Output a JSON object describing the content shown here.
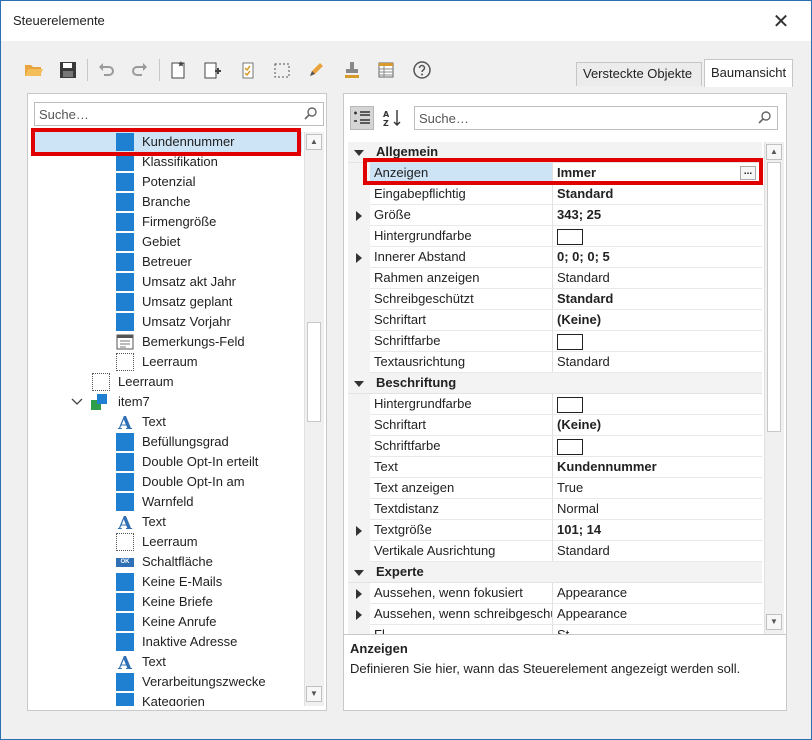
{
  "window": {
    "title": "Steuerelemente",
    "close_glyph": "✕"
  },
  "toolbar": {
    "icons": [
      "open-folder-icon",
      "save-icon",
      "undo-icon",
      "redo-icon",
      "new-document-icon",
      "add-icon",
      "checklist-icon",
      "select-icon",
      "pencil-icon",
      "stamp-icon",
      "table-icon",
      "help-icon"
    ]
  },
  "tabs": {
    "hidden_objects": "Versteckte Objekte",
    "tree_view": "Baumansicht"
  },
  "left": {
    "search_placeholder": "Suche…",
    "items": [
      {
        "label": "Kundennummer",
        "icon": "blue-square"
      },
      {
        "label": "Klassifikation",
        "icon": "blue-square"
      },
      {
        "label": "Potenzial",
        "icon": "blue-square"
      },
      {
        "label": "Branche",
        "icon": "blue-square"
      },
      {
        "label": "Firmengröße",
        "icon": "blue-square"
      },
      {
        "label": "Gebiet",
        "icon": "blue-square"
      },
      {
        "label": "Betreuer",
        "icon": "blue-square"
      },
      {
        "label": "Umsatz akt Jahr",
        "icon": "blue-square"
      },
      {
        "label": "Umsatz geplant",
        "icon": "blue-square"
      },
      {
        "label": "Umsatz Vorjahr",
        "icon": "blue-square"
      },
      {
        "label": "Bemerkungs-Feld",
        "icon": "memo"
      },
      {
        "label": "Leerraum",
        "icon": "dashed"
      },
      {
        "label": "Leerraum",
        "icon": "dashed"
      },
      {
        "label": "item7",
        "icon": "group"
      },
      {
        "label": "Text",
        "icon": "text-a"
      },
      {
        "label": "Befüllungsgrad",
        "icon": "blue-square"
      },
      {
        "label": "Double Opt-In erteilt",
        "icon": "blue-square"
      },
      {
        "label": "Double Opt-In am",
        "icon": "blue-square"
      },
      {
        "label": "Warnfeld",
        "icon": "blue-square"
      },
      {
        "label": "Text",
        "icon": "text-a"
      },
      {
        "label": "Leerraum",
        "icon": "dashed"
      },
      {
        "label": "Schaltfläche",
        "icon": "button-ok"
      },
      {
        "label": "Keine E-Mails",
        "icon": "blue-square"
      },
      {
        "label": "Keine Briefe",
        "icon": "blue-square"
      },
      {
        "label": "Keine Anrufe",
        "icon": "blue-square"
      },
      {
        "label": "Inaktive Adresse",
        "icon": "blue-square"
      },
      {
        "label": "Text",
        "icon": "text-a"
      },
      {
        "label": "Verarbeitungszwecke",
        "icon": "blue-square"
      },
      {
        "label": "Kategorien",
        "icon": "blue-square"
      }
    ],
    "ok_badge": "OK"
  },
  "right": {
    "search_placeholder": "Suche…",
    "categories": {
      "allgemein": "Allgemein",
      "beschriftung": "Beschriftung",
      "experte": "Experte"
    },
    "rows": [
      {
        "name": "Anzeigen",
        "value": "Immer",
        "bold": true
      },
      {
        "name": "Eingabepflichtig",
        "value": "Standard",
        "bold": true
      },
      {
        "name": "Größe",
        "value": "343; 25",
        "bold": true
      },
      {
        "name": "Hintergrundfarbe",
        "value": ""
      },
      {
        "name": "Innerer Abstand",
        "value": "0; 0; 0; 5",
        "bold": true
      },
      {
        "name": "Rahmen anzeigen",
        "value": "Standard"
      },
      {
        "name": "Schreibgeschützt",
        "value": "Standard",
        "bold": true
      },
      {
        "name": "Schriftart",
        "value": "(Keine)",
        "bold": true
      },
      {
        "name": "Schriftfarbe",
        "value": ""
      },
      {
        "name": "Textausrichtung",
        "value": "Standard"
      },
      {
        "name": "Hintergrundfarbe",
        "value": ""
      },
      {
        "name": "Schriftart",
        "value": "(Keine)",
        "bold": true
      },
      {
        "name": "Schriftfarbe",
        "value": ""
      },
      {
        "name": "Text",
        "value": "Kundennummer",
        "bold": true
      },
      {
        "name": "Text anzeigen",
        "value": "True"
      },
      {
        "name": "Textdistanz",
        "value": "Normal"
      },
      {
        "name": "Textgröße",
        "value": "101; 14",
        "bold": true
      },
      {
        "name": "Vertikale Ausrichtung",
        "value": "Standard"
      },
      {
        "name": "Aussehen, wenn fokusiert",
        "value": "Appearance"
      },
      {
        "name": "Aussehen, wenn schreibgeschützt",
        "value": "Appearance"
      },
      {
        "name": "Fl...",
        "value": "St..."
      }
    ],
    "ellipsis": "...",
    "description_title": "Anzeigen",
    "description_text": "Definieren Sie hier, wann das Steuerelement angezeigt werden soll."
  },
  "colors": {
    "accent_blue": "#1f7fd0",
    "highlight_red": "#e00000",
    "selection": "#cde3f6"
  }
}
